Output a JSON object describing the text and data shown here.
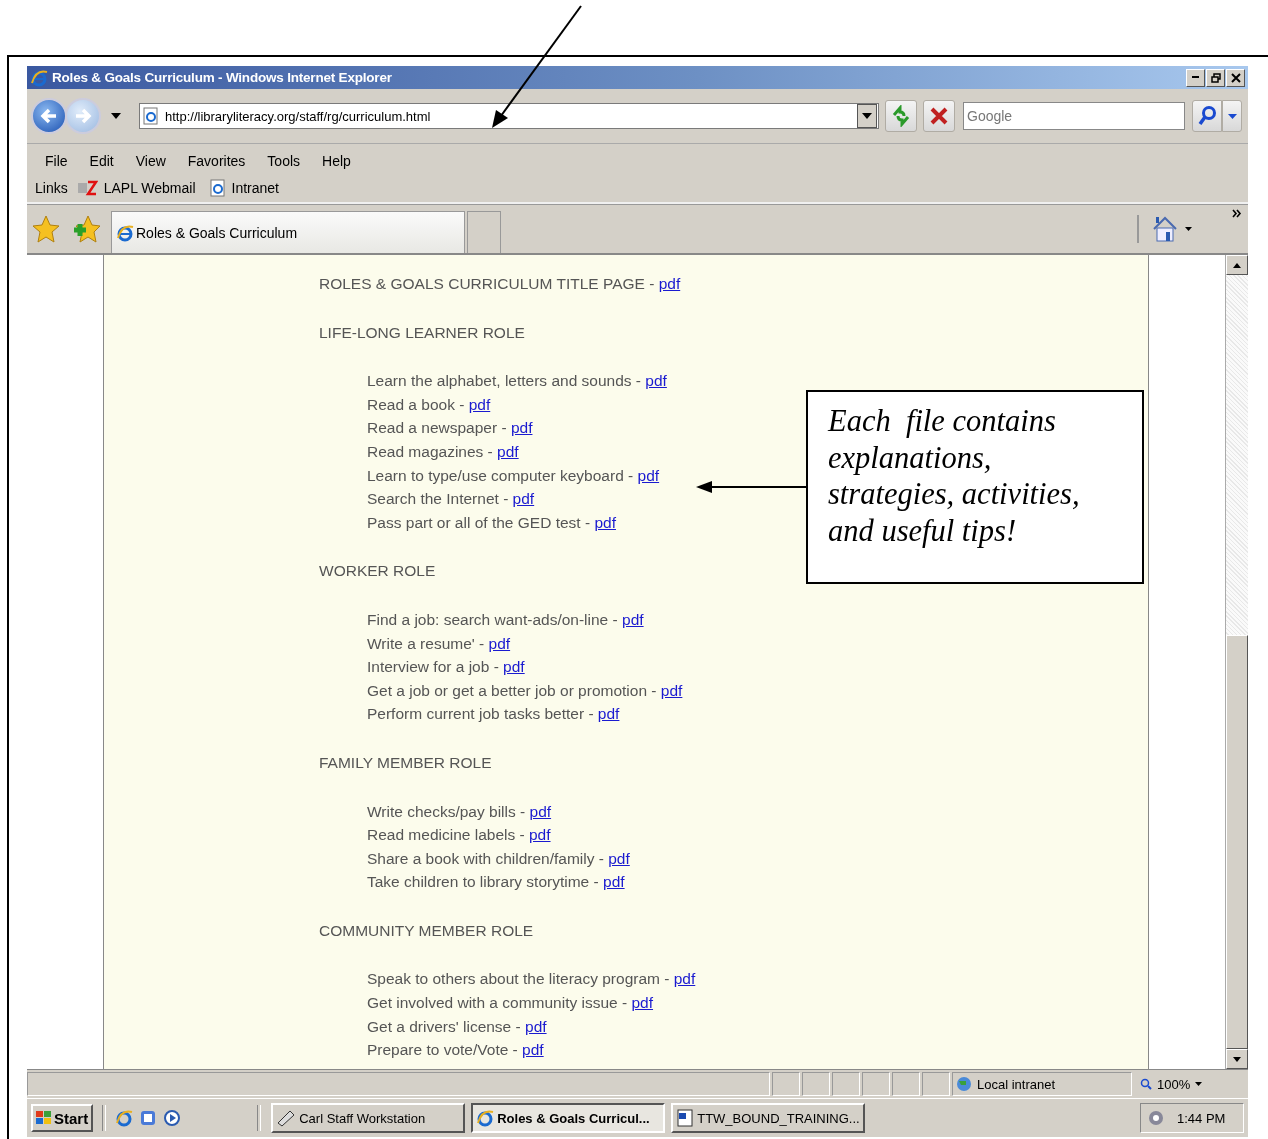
{
  "window": {
    "title": "Roles & Goals Curriculum - Windows Internet Explorer"
  },
  "address_bar": {
    "value": "http://libraryliteracy.org/staff/rg/curriculum.html"
  },
  "search": {
    "placeholder": "Google"
  },
  "menu": [
    "File",
    "Edit",
    "View",
    "Favorites",
    "Tools",
    "Help"
  ],
  "links_bar": {
    "label": "Links",
    "items": [
      {
        "label": "LAPL Webmail",
        "kind": "mail"
      },
      {
        "label": "Intranet",
        "kind": "ie"
      }
    ]
  },
  "tabs": [
    {
      "label": "Roles & Goals Curriculum",
      "selected": true
    }
  ],
  "page": {
    "title_line": {
      "label": "ROLES & GOALS CURRICULUM TITLE PAGE -",
      "link": "pdf"
    },
    "sections": [
      {
        "heading": "LIFE-LONG LEARNER ROLE",
        "items": [
          {
            "label": "Learn the alphabet, letters and sounds -",
            "link": "pdf"
          },
          {
            "label": "Read a book -",
            "link": "pdf"
          },
          {
            "label": "Read a newspaper -",
            "link": "pdf"
          },
          {
            "label": "Read magazines -",
            "link": "pdf"
          },
          {
            "label": "Learn to type/use computer keyboard -",
            "link": "pdf"
          },
          {
            "label": "Search the Internet -",
            "link": "pdf"
          },
          {
            "label": "Pass part or all of the GED test -",
            "link": "pdf"
          }
        ]
      },
      {
        "heading": "WORKER ROLE",
        "items": [
          {
            "label": "Find a job: search want-ads/on-line -",
            "link": "pdf"
          },
          {
            "label": "Write a resume' -",
            "link": "pdf"
          },
          {
            "label": "Interview for a job -",
            "link": "pdf"
          },
          {
            "label": "Get a job or get a better job or promotion -",
            "link": "pdf"
          },
          {
            "label": "Perform current job tasks better -",
            "link": "pdf"
          }
        ]
      },
      {
        "heading": "FAMILY MEMBER ROLE",
        "items": [
          {
            "label": "Write checks/pay bills -",
            "link": "pdf"
          },
          {
            "label": "Read medicine labels -",
            "link": "pdf"
          },
          {
            "label": "Share a book with children/family -",
            "link": "pdf"
          },
          {
            "label": "Take children to library storytime -",
            "link": "pdf"
          }
        ]
      },
      {
        "heading": "COMMUNITY MEMBER ROLE",
        "items": [
          {
            "label": "Speak to others about the literacy program -",
            "link": "pdf"
          },
          {
            "label": "Get involved with a community issue -",
            "link": "pdf"
          },
          {
            "label": "Get a drivers' license -",
            "link": "pdf"
          },
          {
            "label": "Prepare to vote/Vote -",
            "link": "pdf"
          }
        ]
      }
    ]
  },
  "callout": {
    "text": "Each  file contains explanations, strategies, activities, and useful tips!"
  },
  "status_bar": {
    "zone": "Local intranet",
    "zoom": "100%"
  },
  "taskbar": {
    "start": "Start",
    "tasks": [
      {
        "label": "Carl Staff Workstation",
        "kind": "app",
        "selected": false
      },
      {
        "label": "Roles & Goals Curricul...",
        "kind": "ie",
        "selected": true
      },
      {
        "label": "TTW_BOUND_TRAINING...",
        "kind": "word",
        "selected": false
      }
    ],
    "clock": "1:44 PM"
  }
}
